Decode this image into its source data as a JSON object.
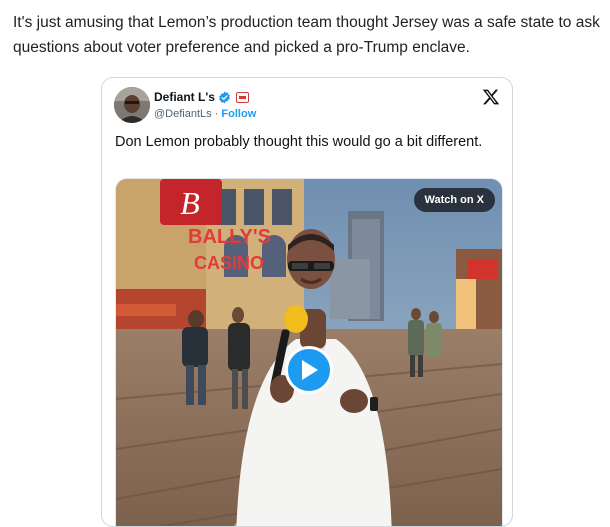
{
  "post": {
    "text": "It's just amusing that Lemon’s production team thought Jersey was a safe state to ask questions about voter preference and picked a pro-Trump enclave."
  },
  "tweet": {
    "author_name": "Defiant L's",
    "handle": "@DefiantLs",
    "separator": " · ",
    "follow_label": "Follow",
    "text": "Don Lemon probably thought this would go a bit different.",
    "watch_label": "Watch on X",
    "verified_color": "#1d9bf0",
    "follow_color": "#1d9bf0",
    "media_signs": [
      "BALLY'S",
      "CASINO"
    ]
  }
}
